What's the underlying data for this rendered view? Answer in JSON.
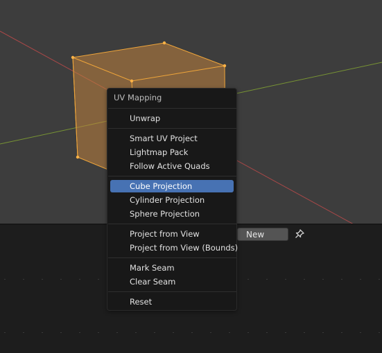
{
  "menu": {
    "title": "UV Mapping",
    "groups": [
      [
        "Unwrap"
      ],
      [
        "Smart UV Project",
        "Lightmap Pack",
        "Follow Active Quads"
      ],
      [
        "Cube Projection",
        "Cylinder Projection",
        "Sphere Projection"
      ],
      [
        "Project from View",
        "Project from View (Bounds)"
      ],
      [
        "Mark Seam",
        "Clear Seam"
      ],
      [
        "Reset"
      ]
    ],
    "active_item": "Cube Projection"
  },
  "header": {
    "new_label": "New"
  },
  "colors": {
    "viewport_bg": "#3d3d3d",
    "selection_orange": "#f5a623",
    "x_axis": "#b04a4a",
    "y_axis": "#7a9a3a",
    "menu_highlight": "#4772b3"
  },
  "icons": [
    "pin-icon"
  ]
}
